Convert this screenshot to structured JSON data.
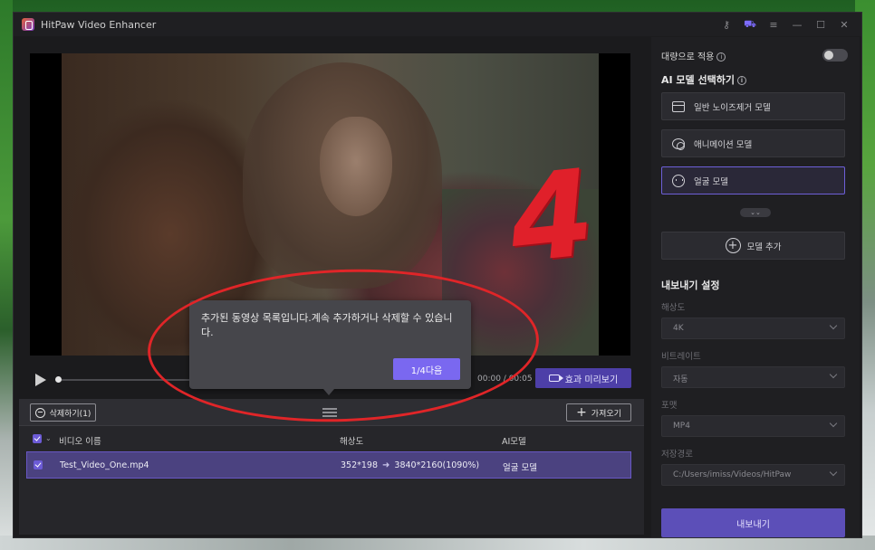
{
  "window": {
    "title": "HitPaw Video Enhancer"
  },
  "titlebar_icons": [
    "key-icon",
    "cart-icon",
    "menu-icon",
    "minimize-icon",
    "maximize-icon",
    "close-icon"
  ],
  "player": {
    "time": "00:00 / 00:05",
    "preview_label": "효과 미리보기",
    "annotation_number": "4"
  },
  "tooltip": {
    "text": "추가된 동영상 목록입니다.계속 추가하거나 삭제할 수 있습니다.",
    "next_label": "1/4다음"
  },
  "list": {
    "delete_label": "삭제하기(1)",
    "import_label": "가져오기",
    "headers": {
      "name": "비디오 이름",
      "resolution": "해상도",
      "ai_model": "AI모델"
    },
    "rows": [
      {
        "name": "Test_Video_One.mp4",
        "res_from": "352*198",
        "res_to": "3840*2160(1090%)",
        "ai_model": "얼굴 모델"
      }
    ]
  },
  "right": {
    "batch_label": "대량으로 적용",
    "ai_title": "AI 모델 선택하기",
    "models": [
      {
        "label": "일반 노이즈제거 모델",
        "icon": "film-icon"
      },
      {
        "label": "애니메이션 모델",
        "icon": "animation-icon"
      },
      {
        "label": "얼굴 모델",
        "icon": "face-icon"
      }
    ],
    "expand": "⌄⌄",
    "add_model": "모델 추가",
    "export_title": "내보내기 설정",
    "fields": [
      {
        "label": "해상도",
        "value": "4K"
      },
      {
        "label": "비트레이트",
        "value": "자동"
      },
      {
        "label": "포맷",
        "value": "MP4"
      },
      {
        "label": "저장경로",
        "value": "C:/Users/imiss/Videos/HitPaw"
      }
    ],
    "export_label": "내보내기"
  },
  "colors": {
    "accent": "#6c5bd6",
    "annotation_red": "#e02528"
  }
}
